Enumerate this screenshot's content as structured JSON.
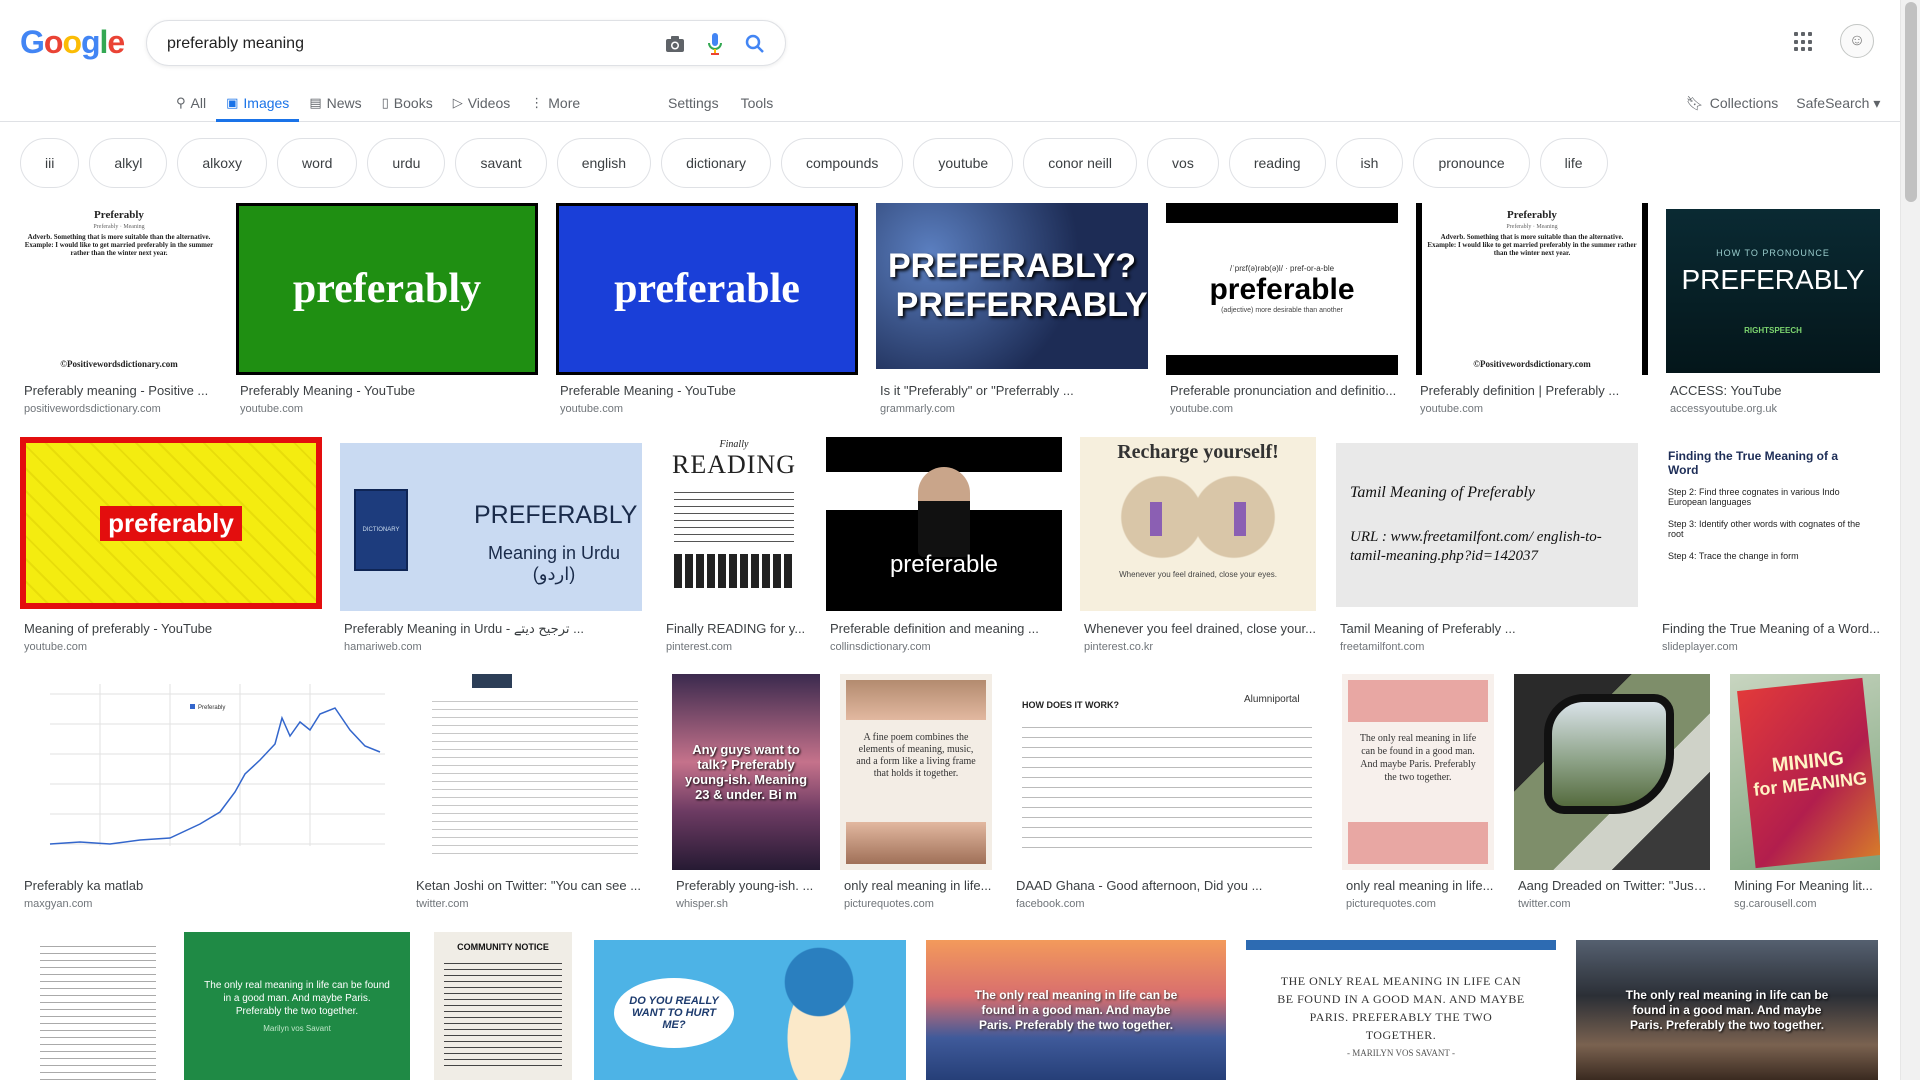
{
  "search": {
    "query": "preferably meaning"
  },
  "logo": {
    "text": "Google"
  },
  "tabs": [
    {
      "label": "All",
      "icon": "search-icon",
      "active": false
    },
    {
      "label": "Images",
      "icon": "image-icon",
      "active": true
    },
    {
      "label": "News",
      "icon": "news-icon",
      "active": false
    },
    {
      "label": "Books",
      "icon": "book-icon",
      "active": false
    },
    {
      "label": "Videos",
      "icon": "video-icon",
      "active": false
    },
    {
      "label": "More",
      "icon": "more-icon",
      "active": false
    }
  ],
  "tools": {
    "settings": "Settings",
    "tools": "Tools"
  },
  "right": {
    "collections": "Collections",
    "safesearch": "SafeSearch"
  },
  "chips": [
    "iii",
    "alkyl",
    "alkoxy",
    "word",
    "urdu",
    "savant",
    "english",
    "dictionary",
    "compounds",
    "youtube",
    "conor neill",
    "vos",
    "reading",
    "ish",
    "pronounce",
    "life"
  ],
  "thumb_text": {
    "t1": {
      "title": "Preferably",
      "sub": "Preferably · Meaning",
      "body": "Adverb. Something that is more suitable than the alternative. Example: I would like to get married preferably in the summer rather than the winter next year.",
      "foot": "©Positivewordsdictionary.com"
    },
    "t2": "preferably",
    "t3": "preferable",
    "t4a": "PREFERABLY?",
    "t4b": "PREFERRABLY?",
    "t5a": "/ˈprɛf(ə)rəb(ə)l/ · pref-or-a-ble",
    "t5b": "preferable",
    "t5c": "(adjective) more desirable than another",
    "t7a": "HOW TO PRONOUNCE",
    "t7b": "PREFERABLY",
    "t7c": "RIGHTSPEECH",
    "t8": "preferably",
    "t9a": "PREFERABLY",
    "t9b": "Meaning in Urdu (اردو)",
    "t9c": "DICTIONARY",
    "t10a": "Finally",
    "t10b": "READING",
    "t11": "preferable",
    "t12a": "Recharge yourself!",
    "t12b": "Whenever you feel drained, close your eyes.",
    "t13a": "Tamil Meaning of Preferably",
    "t13b": "URL : www.freetamilfont.com/ english-to-tamil-meaning.php?id=142037",
    "t14a": "Finding the True Meaning of a Word",
    "t14b": "Step 2: Find three cognates in various Indo European languages",
    "t14c": "Step 3: Identify other words with cognates of the root",
    "t14d": "Step 4: Trace the change in form",
    "t15": "Preferably",
    "t17": "Any guys want to talk? Preferably young-ish. Meaning 23 & under. Bi m",
    "t18": "A fine poem combines the elements of meaning, music, and a form like a living frame that holds it together.",
    "t19a": "HOW DOES IT WORK?",
    "t19b": "Alumniportal",
    "t20": "The only real meaning in life can be found in a good man. And maybe Paris. Preferably the two together.",
    "t22a": "MINING",
    "t22b": "for MEANING",
    "t24": "The only real meaning in life can be found in a good man. And maybe Paris. Preferably the two together.",
    "t24b": "Marilyn vos Savant",
    "t25": "COMMUNITY NOTICE",
    "t26": "DO YOU REALLY WANT TO HURT ME?",
    "t27": "The only real meaning in life can be found in a good man. And maybe Paris. Preferably the two together.",
    "t28": "THE ONLY REAL MEANING IN LIFE CAN BE FOUND IN A GOOD MAN. AND MAYBE PARIS. PREFERABLY THE TWO TOGETHER.",
    "t28b": "- MARILYN VOS SAVANT -",
    "t29": "The only real meaning in life can be found in a good man. And maybe Paris. Preferably the two together."
  },
  "results": [
    {
      "caption": "Preferably meaning - Positive ...",
      "source": "positivewordsdictionary.com"
    },
    {
      "caption": "Preferably Meaning - YouTube",
      "source": "youtube.com"
    },
    {
      "caption": "Preferable Meaning - YouTube",
      "source": "youtube.com"
    },
    {
      "caption": "Is it \"Preferably\" or \"Preferrably ...",
      "source": "grammarly.com"
    },
    {
      "caption": "Preferable pronunciation and definitio...",
      "source": "youtube.com"
    },
    {
      "caption": "Preferably definition | Preferably ...",
      "source": "youtube.com"
    },
    {
      "caption": "ACCESS: YouTube",
      "source": "accessyoutube.org.uk"
    },
    {
      "caption": "Meaning of preferably - YouTube",
      "source": "youtube.com"
    },
    {
      "caption": "Preferably Meaning in Urdu - ترجیح دیتے ...",
      "source": "hamariweb.com"
    },
    {
      "caption": "Finally READING for y...",
      "source": "pinterest.com"
    },
    {
      "caption": "Preferable definition and meaning ...",
      "source": "collinsdictionary.com"
    },
    {
      "caption": "Whenever you feel drained, close your...",
      "source": "pinterest.co.kr"
    },
    {
      "caption": "Tamil Meaning of Preferably ...",
      "source": "freetamilfont.com"
    },
    {
      "caption": "Finding the True Meaning of a Word...",
      "source": "slideplayer.com"
    },
    {
      "caption": "Preferably ka matlab",
      "source": "maxgyan.com"
    },
    {
      "caption": "Ketan Joshi on Twitter: \"You can see ...",
      "source": "twitter.com"
    },
    {
      "caption": "Preferably young-ish. ...",
      "source": "whisper.sh"
    },
    {
      "caption": "only real meaning in life...",
      "source": "picturequotes.com"
    },
    {
      "caption": "DAAD Ghana - Good afternoon, Did you ...",
      "source": "facebook.com"
    },
    {
      "caption": "only real meaning in life...",
      "source": "picturequotes.com"
    },
    {
      "caption": "Aang Dreaded on Twitter: \"Just ...",
      "source": "twitter.com"
    },
    {
      "caption": "Mining For Meaning lit...",
      "source": "sg.carousell.com"
    }
  ]
}
